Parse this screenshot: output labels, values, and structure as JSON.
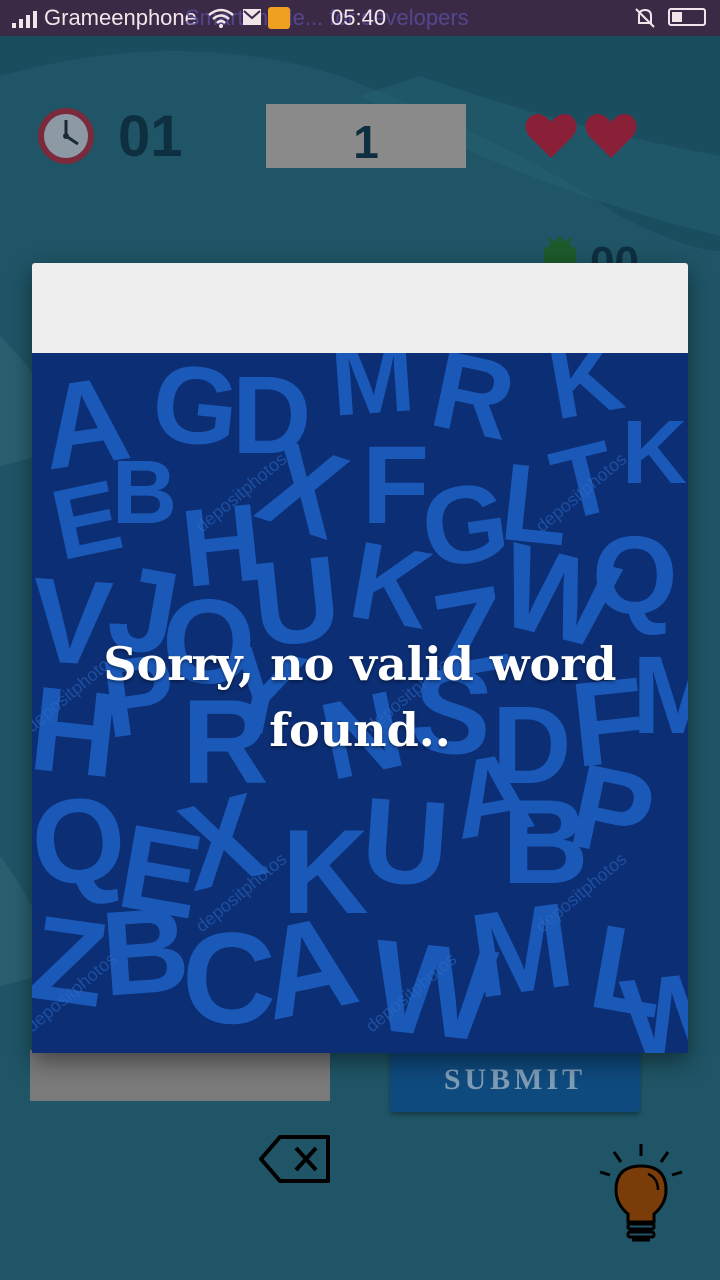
{
  "status_bar": {
    "carrier": "Grameenphone",
    "background_text": "Smart mode... for developers",
    "time": "05:40",
    "icons": [
      "signal-icon",
      "wifi-icon",
      "mail-icon",
      "notification-icon",
      "mute-icon",
      "battery-icon"
    ]
  },
  "game": {
    "timer": "01",
    "score": "1",
    "lives": 2,
    "coins": "00",
    "icons": [
      "clock-icon",
      "heart-icon",
      "money-bag-icon",
      "backspace-icon",
      "lightbulb-icon"
    ]
  },
  "dialog": {
    "message_line1": "Sorry, no valid word",
    "message_line2": "found..",
    "background_watermark": "depositphotos",
    "background_letters": "A G D M R K T E B H X F G L K V J U K Z Q O W H P Y N S D A I B R M Q E X U K L Z B C A W"
  },
  "controls": {
    "submit_label": "SUBMIT"
  },
  "colors": {
    "page_bg": "#1f5566",
    "dialog_bg": "#0c2e74",
    "letters": "#1e5fc0",
    "submit_bg": "#0f4a7e",
    "heart": "#8a1f38"
  }
}
